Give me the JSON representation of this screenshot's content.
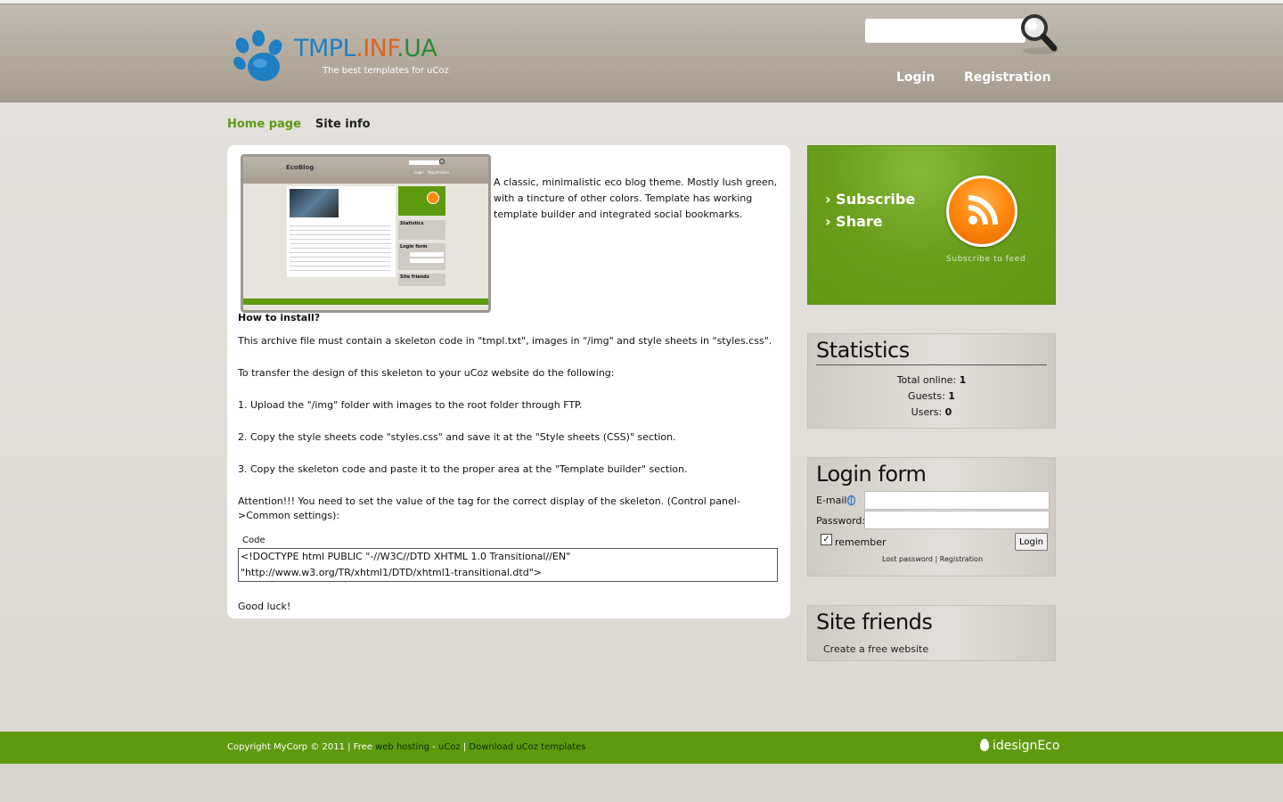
{
  "header": {
    "logo": {
      "part1": "TMPL",
      "part2": ".INF",
      "part3": ".UA",
      "tagline": "The best templates for uCoz"
    },
    "search": {
      "placeholder": ""
    },
    "nav": {
      "login": "Login",
      "registration": "Registration"
    }
  },
  "breadcrumb": {
    "home": "Home page",
    "current": "Site info"
  },
  "content": {
    "description": "A classic, minimalistic eco blog theme. Mostly lush green, with a tincture of other colors. Template has working template builder and integrated social bookmarks.",
    "preview": {
      "title": "EcoBlog",
      "login": "Login",
      "registration": "Registration",
      "statistics": "Statistics",
      "login_form": "Login form",
      "site_friends": "Site friends"
    },
    "heading": "How to install?",
    "paragraphs": [
      "This archive file must contain a skeleton code in \"tmpl.txt\", images in \"/img\" and style sheets in \"styles.css\".",
      "To transfer the design of this skeleton to your uCoz website do the following:",
      "1. Upload the \"/img\" folder with images to the root folder through FTP.",
      "2. Copy the style sheets code \"styles.css\" and save it at the \"Style sheets (CSS)\" section.",
      "3. Copy the skeleton code and paste it to the proper area at the \"Template builder\" section.",
      "Attention!!! You need to set the value of the tag for the correct display of the skeleton. (Control panel->Common settings):"
    ],
    "code_label": "Code",
    "code": "<!DOCTYPE html PUBLIC \"-//W3C//DTD XHTML 1.0 Transitional//EN\" \"http://www.w3.org/TR/xhtml1/DTD/xhtml1-transitional.dtd\">",
    "closing": "Good luck!"
  },
  "sidebar": {
    "subscribe": {
      "subscribe": "› Subscribe",
      "share": "› Share",
      "feed": "Subscribe to feed"
    },
    "statistics": {
      "title": "Statistics",
      "rows": [
        {
          "label": "Total online:",
          "value": "1"
        },
        {
          "label": "Guests:",
          "value": "1"
        },
        {
          "label": "Users:",
          "value": "0"
        }
      ]
    },
    "login_form": {
      "title": "Login form",
      "email_label": "E-mail:",
      "password_label": "Password:",
      "remember": "remember",
      "button": "Login",
      "lost_password": "Lost password",
      "registration": "Registration"
    },
    "site_friends": {
      "title": "Site friends",
      "link": "Create a free website"
    }
  },
  "footer": {
    "copyright": "Copyright MyCorp © 2011 | Free",
    "hosting": "web hosting",
    "ucoz": "uCoz",
    "download": "Download uCoz templates",
    "brand": "idesignEco"
  },
  "colors": {
    "accent_green": "#5e9a0e",
    "header": "#b2a99c",
    "rss_orange": "#ff8a10"
  }
}
